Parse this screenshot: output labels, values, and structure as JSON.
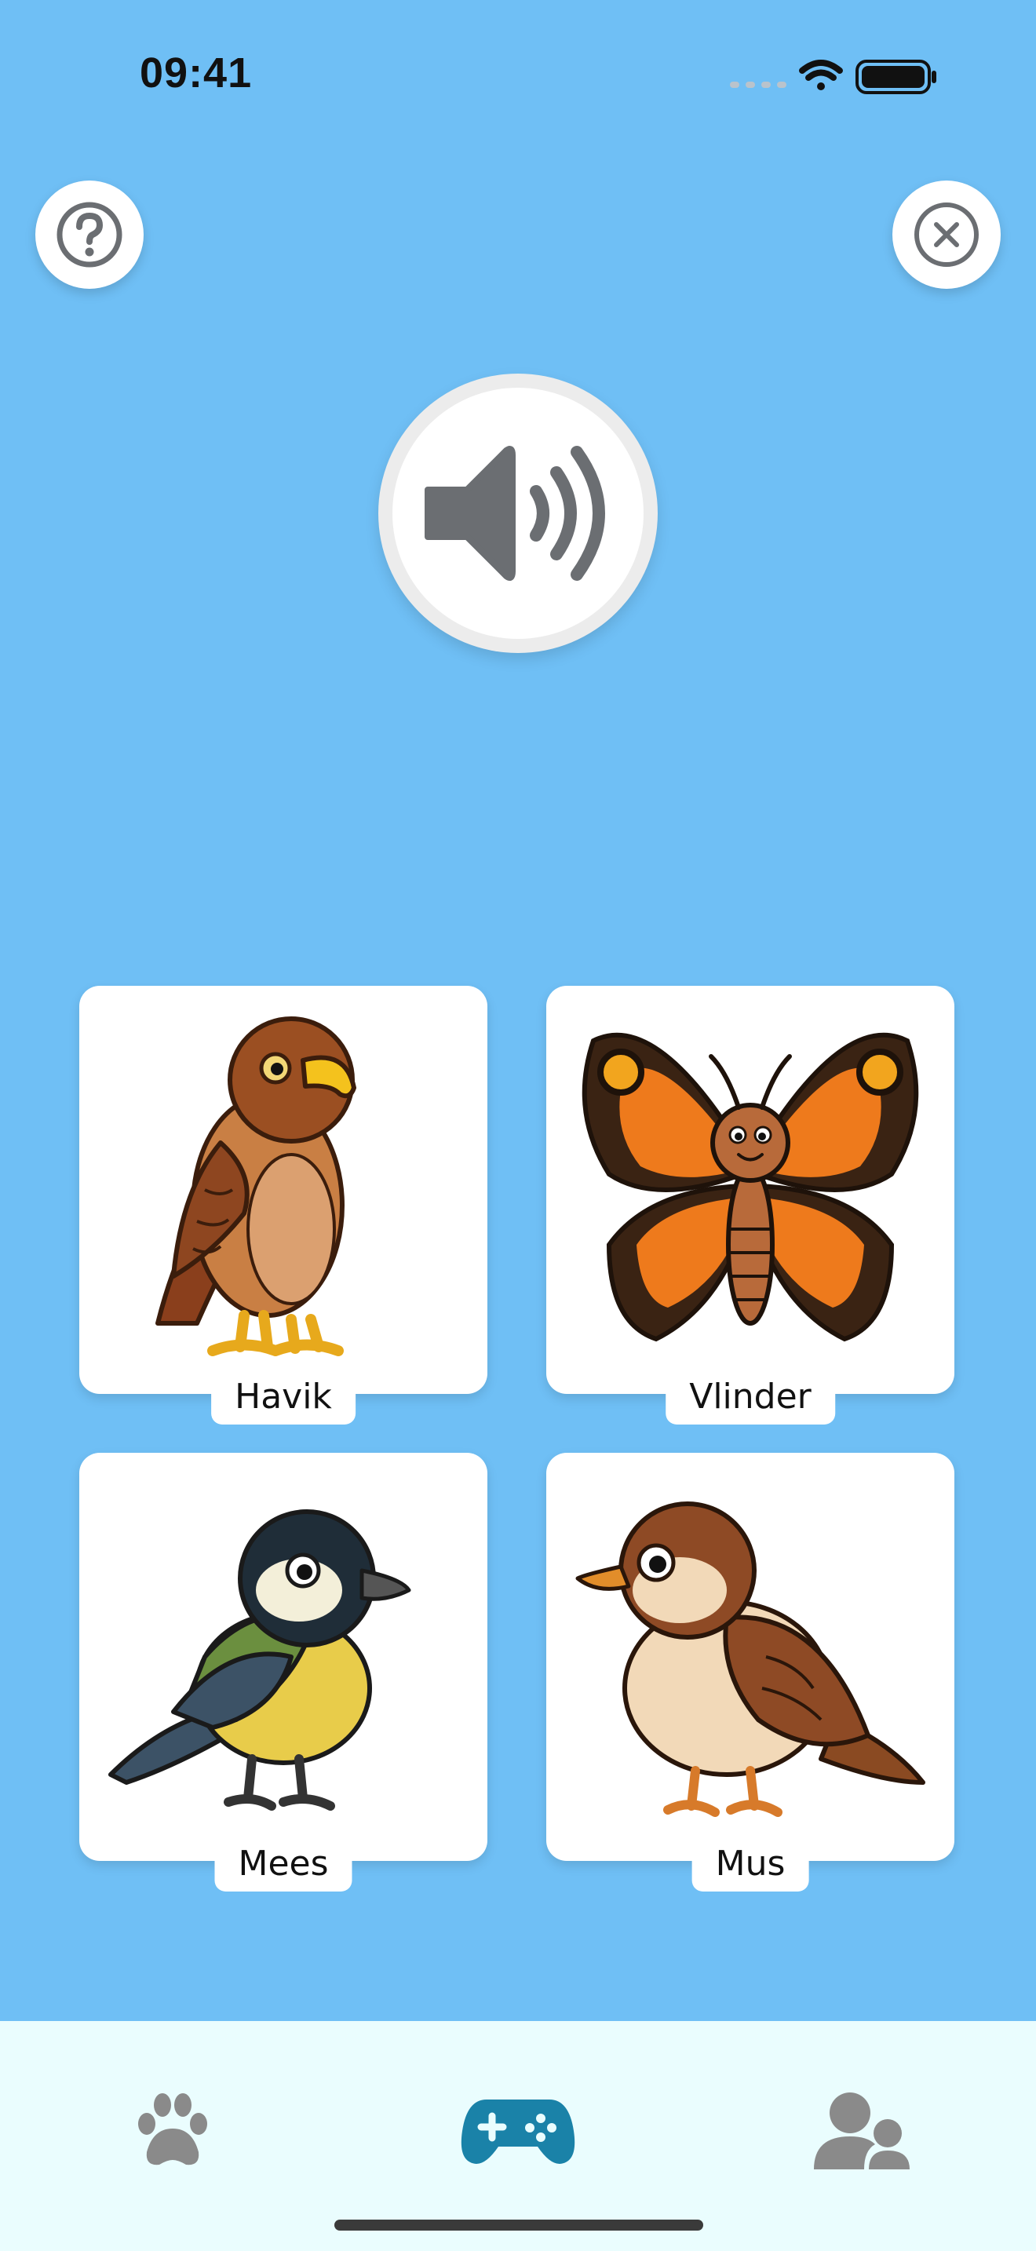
{
  "status_bar": {
    "time": "09:41"
  },
  "header": {
    "help_icon": "question-circle-icon",
    "close_icon": "close-circle-icon"
  },
  "audio": {
    "icon": "speaker-wave-icon"
  },
  "cards": [
    {
      "label": "Havik",
      "image": "hawk"
    },
    {
      "label": "Vlinder",
      "image": "butterfly"
    },
    {
      "label": "Mees",
      "image": "tit-bird"
    },
    {
      "label": "Mus",
      "image": "sparrow"
    }
  ],
  "tabbar": {
    "items": [
      {
        "icon": "paw-icon",
        "active": false
      },
      {
        "icon": "gamepad-icon",
        "active": true
      },
      {
        "icon": "profile-users-icon",
        "active": false
      }
    ]
  },
  "colors": {
    "background": "#6fbff5",
    "tabbar_background": "#eafdfe",
    "active_tab": "#1a82a8",
    "inactive_tab": "#8a8a8a",
    "icon_gray": "#6b6e72"
  }
}
